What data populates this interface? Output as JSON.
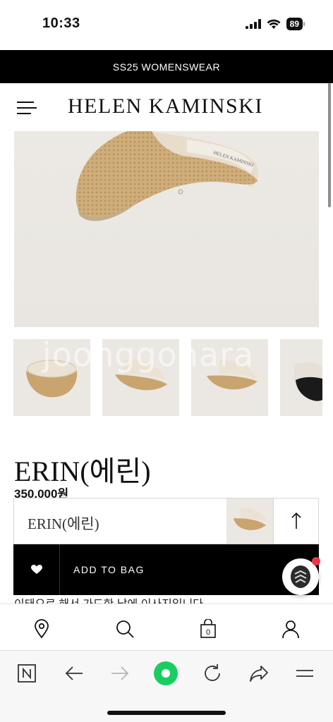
{
  "status_bar": {
    "time": "10:33",
    "battery": "89"
  },
  "promo_banner": {
    "text": "SS25 WOMENSWEAR"
  },
  "header": {
    "brand": "HELEN KAMINSKI",
    "menu_icon": "hamburger-menu-icon"
  },
  "gallery": {
    "watermark": "joonggonara",
    "thumbnails": [
      {
        "color": "natural"
      },
      {
        "color": "natural"
      },
      {
        "color": "natural"
      },
      {
        "color": "black"
      }
    ]
  },
  "product": {
    "name": "ERIN(에린)",
    "price": "350,000원"
  },
  "sticky_bar": {
    "name": "ERIN(에린)",
    "add_to_bag": "ADD TO BAG"
  },
  "cutoff_text": "이태오로 해서 가드한 남에 이사지입니다",
  "site_nav": {
    "items": [
      "location-pin-icon",
      "search-icon",
      "shopping-bag-icon",
      "user-icon"
    ],
    "bag_count": "0"
  },
  "browser_toolbar": {
    "items": [
      "naver-n-icon",
      "back-arrow-icon",
      "forward-arrow-icon",
      "green-home-icon",
      "reload-icon",
      "share-icon",
      "menu-icon"
    ]
  },
  "colors": {
    "black": "#000000",
    "accent_green": "#19ce60",
    "straw": "#c9a46f",
    "notification_red": "#e63946"
  }
}
